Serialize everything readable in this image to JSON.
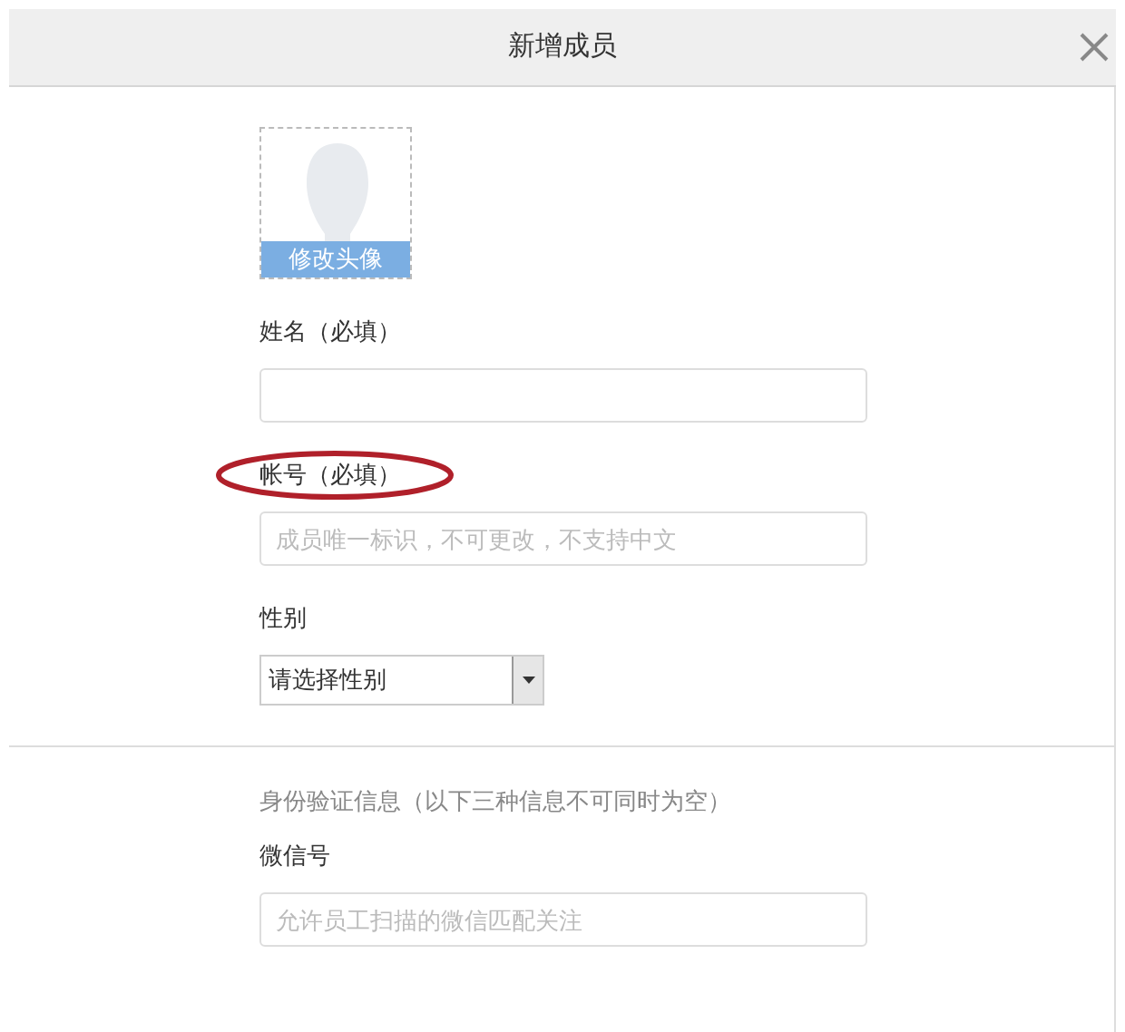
{
  "dialog": {
    "title": "新增成员"
  },
  "avatar": {
    "button": "修改头像"
  },
  "basic_fields": [
    {
      "kind": "text",
      "label": "姓名（必填）",
      "highlighted": false
    },
    {
      "kind": "text",
      "label": "帐号（必填）",
      "placeholder": "成员唯一标识，不可更改，不支持中文",
      "highlighted": true
    },
    {
      "kind": "select",
      "label": "性别",
      "value": "请选择性别",
      "highlighted": false
    }
  ],
  "verification": {
    "note": "身份验证信息（以下三种信息不可同时为空）",
    "fields": [
      {
        "kind": "text",
        "label": "微信号",
        "placeholder": "允许员工扫描的微信匹配关注",
        "highlighted": false
      }
    ]
  }
}
